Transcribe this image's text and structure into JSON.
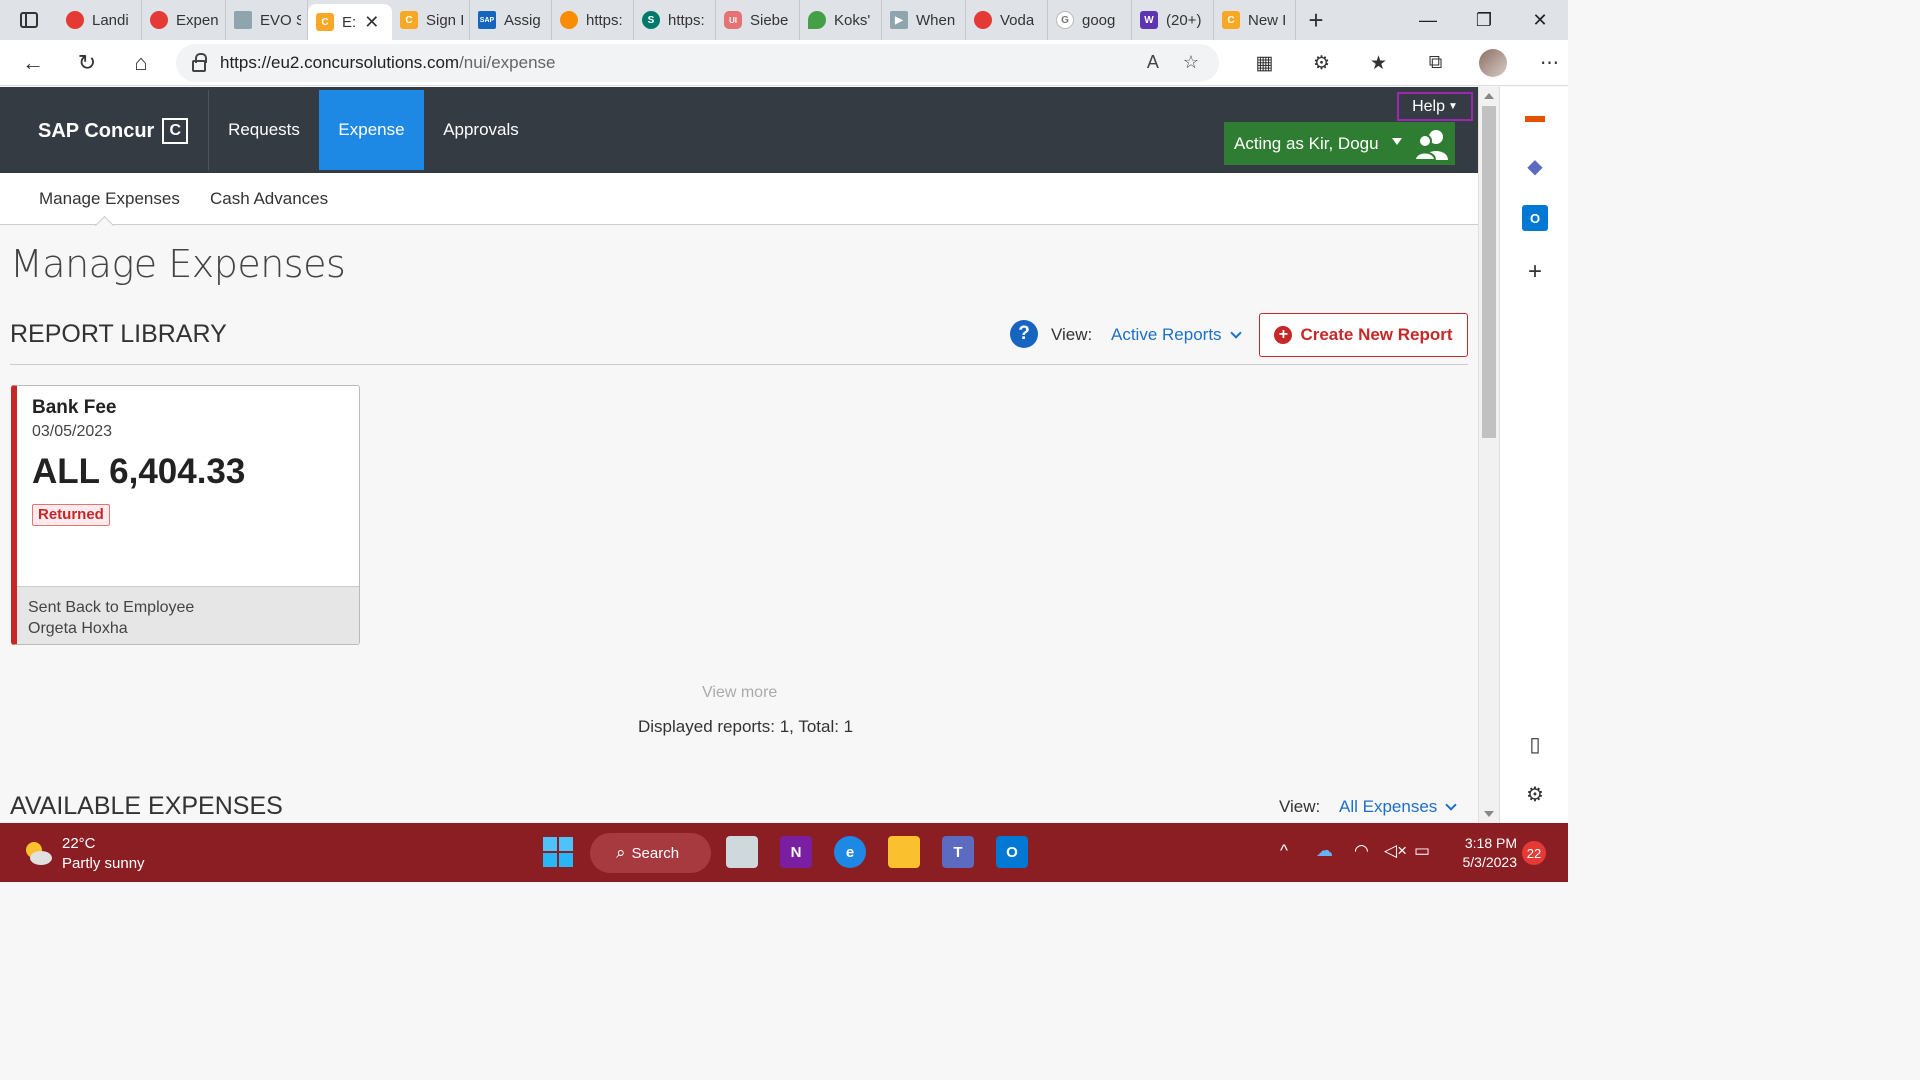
{
  "browser": {
    "tabs": [
      {
        "title": "Landi",
        "icon": "opera-icon",
        "color": "#e53935"
      },
      {
        "title": "Expen",
        "icon": "opera-icon",
        "color": "#e53935"
      },
      {
        "title": "EVO S",
        "icon": "document-icon",
        "color": "#90a4ae"
      },
      {
        "title": "E:",
        "icon": "concur-icon",
        "color": "#f9a825",
        "active": true
      },
      {
        "title": "Sign I",
        "icon": "concur-icon",
        "color": "#f9a825"
      },
      {
        "title": "Assig",
        "icon": "sap-icon",
        "color": "#1565c0"
      },
      {
        "title": "https:",
        "icon": "circle-icon",
        "color": "#fb8c00"
      },
      {
        "title": "https:",
        "icon": "sharepoint-icon",
        "color": "#00796b"
      },
      {
        "title": "Siebe",
        "icon": "ui-icon",
        "color": "#e57373"
      },
      {
        "title": "Koks'",
        "icon": "maps-pin-icon",
        "color": "#43a047"
      },
      {
        "title": "When",
        "icon": "video-icon",
        "color": "#90a4ae"
      },
      {
        "title": "Voda",
        "icon": "vodafone-icon",
        "color": "#e53935"
      },
      {
        "title": "goog",
        "icon": "google-icon",
        "color": "#bdbdbd"
      },
      {
        "title": "(20+)",
        "icon": "workplace-icon",
        "color": "#5e35b1"
      },
      {
        "title": "New I",
        "icon": "concur-icon",
        "color": "#f9a825"
      }
    ],
    "url_host": "https://eu2.concursolutions.com",
    "url_path": "/nui/expense"
  },
  "concur": {
    "logo": "SAP Concur",
    "logo_mark": "C",
    "nav": {
      "requests": "Requests",
      "expense": "Expense",
      "approvals": "Approvals"
    },
    "help": "Help",
    "acting_as": "Acting as Kir, Dogu",
    "subnav": {
      "manage": "Manage Expenses",
      "cash": "Cash Advances"
    },
    "page_title": "Manage Expenses",
    "report_library": {
      "title": "REPORT LIBRARY",
      "help_symbol": "?",
      "view_label": "View:",
      "view_value": "Active Reports",
      "create_button": "Create New Report",
      "create_symbol": "+"
    },
    "report_card": {
      "name": "Bank Fee",
      "date": "03/05/2023",
      "amount": "ALL 6,404.33",
      "status": "Returned",
      "footer_status": "Sent Back to Employee",
      "footer_person": "Orgeta Hoxha"
    },
    "view_more": "View more",
    "displayed": "Displayed reports: 1, Total: 1",
    "available_expenses": {
      "title": "AVAILABLE EXPENSES",
      "view_label": "View:",
      "view_value": "All Expenses"
    }
  },
  "taskbar": {
    "temperature": "22°C",
    "weather": "Partly sunny",
    "search": "Search",
    "time": "3:18 PM",
    "date": "5/3/2023",
    "notifications": "22"
  },
  "colors": {
    "nav_bg": "#353b43",
    "nav_active": "#1e88e5",
    "acting_bg": "#2e7d32",
    "accent_red": "#c62828",
    "link_blue": "#1e6fc7",
    "taskbar": "#8b1e23"
  }
}
